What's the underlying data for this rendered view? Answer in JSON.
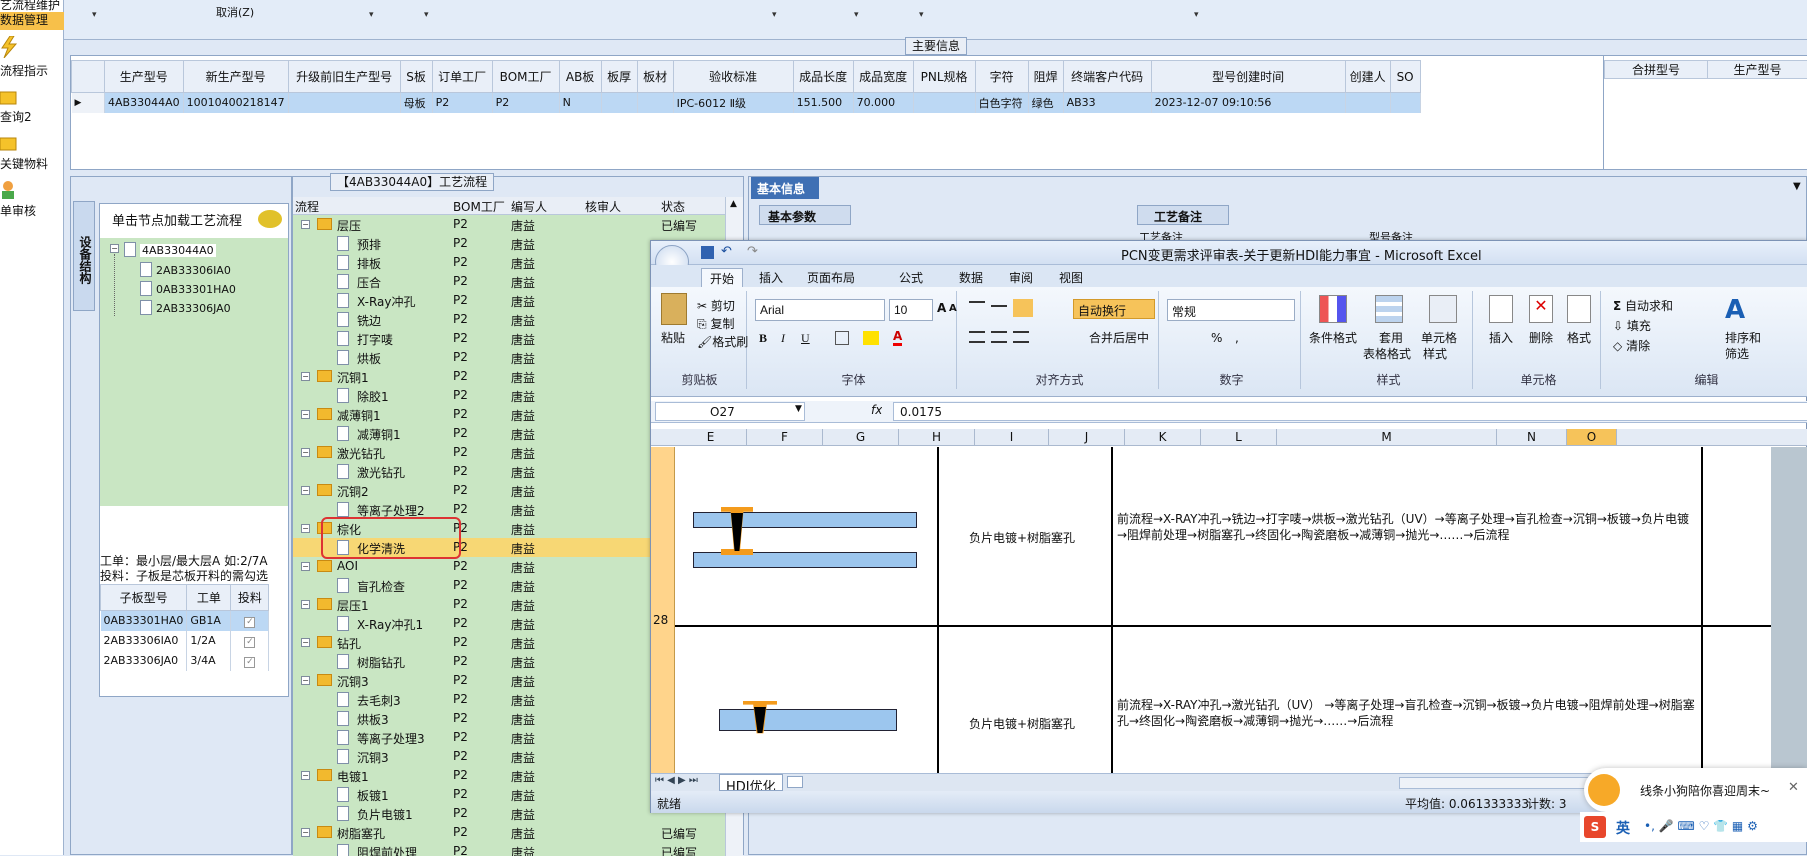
{
  "nav": {
    "items": [
      "艺流程维护",
      "数据管理",
      "流程指示",
      "查询2",
      "关键物料",
      "单审核"
    ]
  },
  "top": {
    "cancel": "取消(Z)"
  },
  "main_info": {
    "caption": "主要信息",
    "columns": [
      "生产型号",
      "新生产型号",
      "升级前旧生产型号",
      "S板",
      "订单工厂",
      "BOM工厂",
      "AB板",
      "板厚",
      "板材",
      "验收标准",
      "成品长度",
      "成品宽度",
      "PNL规格",
      "字符",
      "阻焊",
      "终端客户代码",
      "型号创建时间",
      "创建人",
      "SO"
    ],
    "row": [
      "4AB33044A0",
      "10010400218147",
      "",
      "母板",
      "P2",
      "P2",
      "N",
      "",
      "",
      "IPC-6012 Ⅱ级",
      "151.500",
      "70.000",
      "",
      "白色字符",
      "绿色",
      "AB33",
      "2023-12-07 09:10:56",
      "",
      ""
    ],
    "right_columns": [
      "合拼型号",
      "生产型号"
    ]
  },
  "device_structure": {
    "vertical_tab": "设备结构",
    "hint": "单击节点加载工艺流程",
    "root": "4AB33044A0",
    "children": [
      "2AB33306IA0",
      "0AB33301HA0",
      "2AB33306JA0"
    ],
    "work_line1": "工单：最小层/最大层A 如:2/7A",
    "work_line2": "投料：子板是芯板开料的需勾选",
    "sub_columns": [
      "子板型号",
      "工单",
      "投料"
    ],
    "sub_rows": [
      [
        "0AB33301HA0",
        "GB1A"
      ],
      [
        "2AB33306IA0",
        "1/2A"
      ],
      [
        "2AB33306JA0",
        "3/4A"
      ]
    ]
  },
  "process": {
    "caption": "【4AB33044A0】工艺流程",
    "columns": [
      "流程",
      "BOM工厂",
      "编写人",
      "核审人",
      "状态"
    ],
    "rows": [
      {
        "name": "层压",
        "level": 0,
        "bom": "P2",
        "writer": "唐益",
        "status": "已编写"
      },
      {
        "name": "预排",
        "level": 1,
        "bom": "P2",
        "writer": "唐益",
        "status": ""
      },
      {
        "name": "排板",
        "level": 1,
        "bom": "P2",
        "writer": "唐益",
        "status": ""
      },
      {
        "name": "压合",
        "level": 1,
        "bom": "P2",
        "writer": "唐益",
        "status": ""
      },
      {
        "name": "X-Ray冲孔",
        "level": 1,
        "bom": "P2",
        "writer": "唐益",
        "status": ""
      },
      {
        "name": "铣边",
        "level": 1,
        "bom": "P2",
        "writer": "唐益",
        "status": ""
      },
      {
        "name": "打字唛",
        "level": 1,
        "bom": "P2",
        "writer": "唐益",
        "status": ""
      },
      {
        "name": "烘板",
        "level": 1,
        "bom": "P2",
        "writer": "唐益",
        "status": ""
      },
      {
        "name": "沉铜1",
        "level": 0,
        "bom": "P2",
        "writer": "唐益",
        "status": ""
      },
      {
        "name": "除胶1",
        "level": 1,
        "bom": "P2",
        "writer": "唐益",
        "status": ""
      },
      {
        "name": "减薄铜1",
        "level": 0,
        "bom": "P2",
        "writer": "唐益",
        "status": ""
      },
      {
        "name": "减薄铜1",
        "level": 1,
        "bom": "P2",
        "writer": "唐益",
        "status": ""
      },
      {
        "name": "激光钻孔",
        "level": 0,
        "bom": "P2",
        "writer": "唐益",
        "status": ""
      },
      {
        "name": "激光钻孔",
        "level": 1,
        "bom": "P2",
        "writer": "唐益",
        "status": ""
      },
      {
        "name": "沉铜2",
        "level": 0,
        "bom": "P2",
        "writer": "唐益",
        "status": ""
      },
      {
        "name": "等离子处理2",
        "level": 1,
        "bom": "P2",
        "writer": "唐益",
        "status": ""
      },
      {
        "name": "棕化",
        "level": 0,
        "bom": "P2",
        "writer": "唐益",
        "status": ""
      },
      {
        "name": "化学清洗",
        "level": 1,
        "bom": "P2",
        "writer": "唐益",
        "status": ""
      },
      {
        "name": "AOI",
        "level": 0,
        "bom": "P2",
        "writer": "唐益",
        "status": ""
      },
      {
        "name": "盲孔检查",
        "level": 1,
        "bom": "P2",
        "writer": "唐益",
        "status": ""
      },
      {
        "name": "层压1",
        "level": 0,
        "bom": "P2",
        "writer": "唐益",
        "status": ""
      },
      {
        "name": "X-Ray冲孔1",
        "level": 1,
        "bom": "P2",
        "writer": "唐益",
        "status": ""
      },
      {
        "name": "钻孔",
        "level": 0,
        "bom": "P2",
        "writer": "唐益",
        "status": ""
      },
      {
        "name": "树脂钻孔",
        "level": 1,
        "bom": "P2",
        "writer": "唐益",
        "status": ""
      },
      {
        "name": "沉铜3",
        "level": 0,
        "bom": "P2",
        "writer": "唐益",
        "status": ""
      },
      {
        "name": "去毛刺3",
        "level": 1,
        "bom": "P2",
        "writer": "唐益",
        "status": ""
      },
      {
        "name": "烘板3",
        "level": 1,
        "bom": "P2",
        "writer": "唐益",
        "status": ""
      },
      {
        "name": "等离子处理3",
        "level": 1,
        "bom": "P2",
        "writer": "唐益",
        "status": ""
      },
      {
        "name": "沉铜3",
        "level": 1,
        "bom": "P2",
        "writer": "唐益",
        "status": ""
      },
      {
        "name": "电镀1",
        "level": 0,
        "bom": "P2",
        "writer": "唐益",
        "status": ""
      },
      {
        "name": "板镀1",
        "level": 1,
        "bom": "P2",
        "writer": "唐益",
        "status": ""
      },
      {
        "name": "负片电镀1",
        "level": 1,
        "bom": "P2",
        "writer": "唐益",
        "status": ""
      },
      {
        "name": "树脂塞孔",
        "level": 0,
        "bom": "P2",
        "writer": "唐益",
        "status": "已编写"
      },
      {
        "name": "阻焊前处理",
        "level": 1,
        "bom": "P2",
        "writer": "唐益",
        "status": "已编写"
      }
    ]
  },
  "basic_info": {
    "title": "基本信息",
    "tab1": "基本参数",
    "tab2": "工艺备注",
    "field1": "工艺备注",
    "field2": "型号备注"
  },
  "excel": {
    "title": "PCN变更需求评审表-关于更新HDI能力事宜 - Microsoft Excel",
    "tabs": [
      "开始",
      "插入",
      "页面布局",
      "公式",
      "数据",
      "审阅",
      "视图"
    ],
    "clipboard": {
      "paste": "粘贴",
      "cut": "剪切",
      "copy": "复制",
      "format_painter": "格式刷",
      "label": "剪贴板"
    },
    "font": {
      "name": "Arial",
      "size": "10",
      "label": "字体",
      "bold": "B",
      "italic": "I",
      "underline": "U",
      "grow": "A",
      "shrink": "A"
    },
    "align": {
      "wrap": "自动换行",
      "merge": "合并后居中",
      "label": "对齐方式"
    },
    "number": {
      "format": "常规",
      "percent": "%",
      "comma": ",",
      "label": "数字"
    },
    "styles": {
      "cond": "条件格式",
      "table1": "套用",
      "table2": "表格格式",
      "cell1": "单元格",
      "cell2": "样式",
      "label": "样式"
    },
    "cells": {
      "insert": "插入",
      "delete": "删除",
      "format": "格式",
      "label": "单元格"
    },
    "editing": {
      "autosum": "自动求和",
      "fill": "填充",
      "clear": "清除",
      "sort1": "排序和",
      "sort2": "筛选",
      "label": "编辑"
    },
    "namebox": "O27",
    "fx": "fx",
    "formula": "0.0175",
    "columns": [
      "E",
      "F",
      "G",
      "H",
      "I",
      "J",
      "K",
      "L",
      "M",
      "N",
      "O"
    ],
    "row_number": "28",
    "cells_text": {
      "r1_h": "负片电镀+树脂塞孔",
      "r1_j": "前流程→X-RAY冲孔→铣边→打字唛→烘板→激光钻孔（UV）→等离子处理→盲孔检查→沉铜→板镀→负片电镀→阻焊前处理→树脂塞孔→终固化→陶瓷磨板→减薄铜→抛光→……→后流程",
      "r2_h": "负片电镀+树脂塞孔",
      "r2_j": "前流程→X-RAY冲孔→激光钻孔（UV） →等离子处理→盲孔检查→沉铜→板镀→负片电镀→阻焊前处理→树脂塞孔→终固化→陶瓷磨板→减薄铜→抛光→……→后流程"
    },
    "sheet_tab": "HDI优化",
    "status_ready": "就绪",
    "status_avg": "平均值: 0.061333333",
    "status_count": "计数: 3"
  },
  "notify": {
    "text": "线条小狗陪你喜迎周末~"
  },
  "ime": {
    "label": "英"
  }
}
